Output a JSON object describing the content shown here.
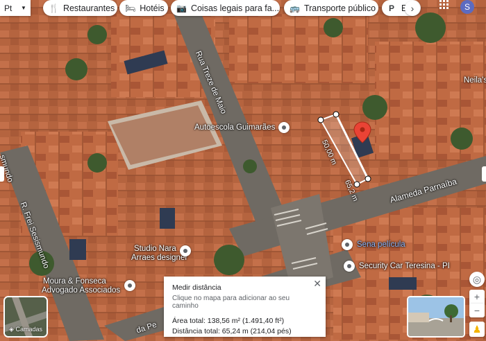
{
  "topbar": {
    "language": "Pt",
    "chips": [
      {
        "label": "Restaurantes",
        "icon": "fork-knife-icon"
      },
      {
        "label": "Hotéis",
        "icon": "bed-icon"
      },
      {
        "label": "Coisas legais para fa...",
        "icon": "camera-icon"
      },
      {
        "label": "Transporte público",
        "icon": "bus-icon"
      },
      {
        "label": "E",
        "icon": "parking-icon"
      }
    ],
    "next_icon": "chevron-right-icon",
    "apps_icon": "apps-grid-icon",
    "avatar_letter": "S"
  },
  "map": {
    "streets": {
      "rua_treze": "Rua Treze de Maio",
      "frei": "R. Frei Sesismundo",
      "alameda": "Alameda Parnaíba",
      "bottom": "da Pe",
      "left": "smundo"
    },
    "places": {
      "autoescola": "Autoescola Guimarães",
      "studio_line1": "Studio Nara",
      "studio_line2": "Arraes designer",
      "moura_line1": "Moura & Fonseca",
      "moura_line2": "Advogado Associados",
      "sena": "Sena película",
      "security": "Security Car Teresina - PI",
      "neila": "Neila's"
    },
    "measure": {
      "segment1": "50,00 m",
      "segment2": "65,2 m"
    },
    "colors": {
      "measure_line": "#ffffff",
      "pin": "#ea4335",
      "poi_blue": "#8ab4f8"
    }
  },
  "distance_panel": {
    "title": "Medir distância",
    "hint": "Clique no mapa para adicionar ao seu caminho",
    "area": "Área total: 138,56 m² (1.491,40 ft²)",
    "distance": "Distância total: 65,24 m (214,04 pés)",
    "close_icon": "close-icon"
  },
  "controls": {
    "layers_label": "Camadas",
    "compass_icon": "compass-icon",
    "zoom_in": "+",
    "zoom_out": "−",
    "pegman_icon": "pegman-icon"
  }
}
